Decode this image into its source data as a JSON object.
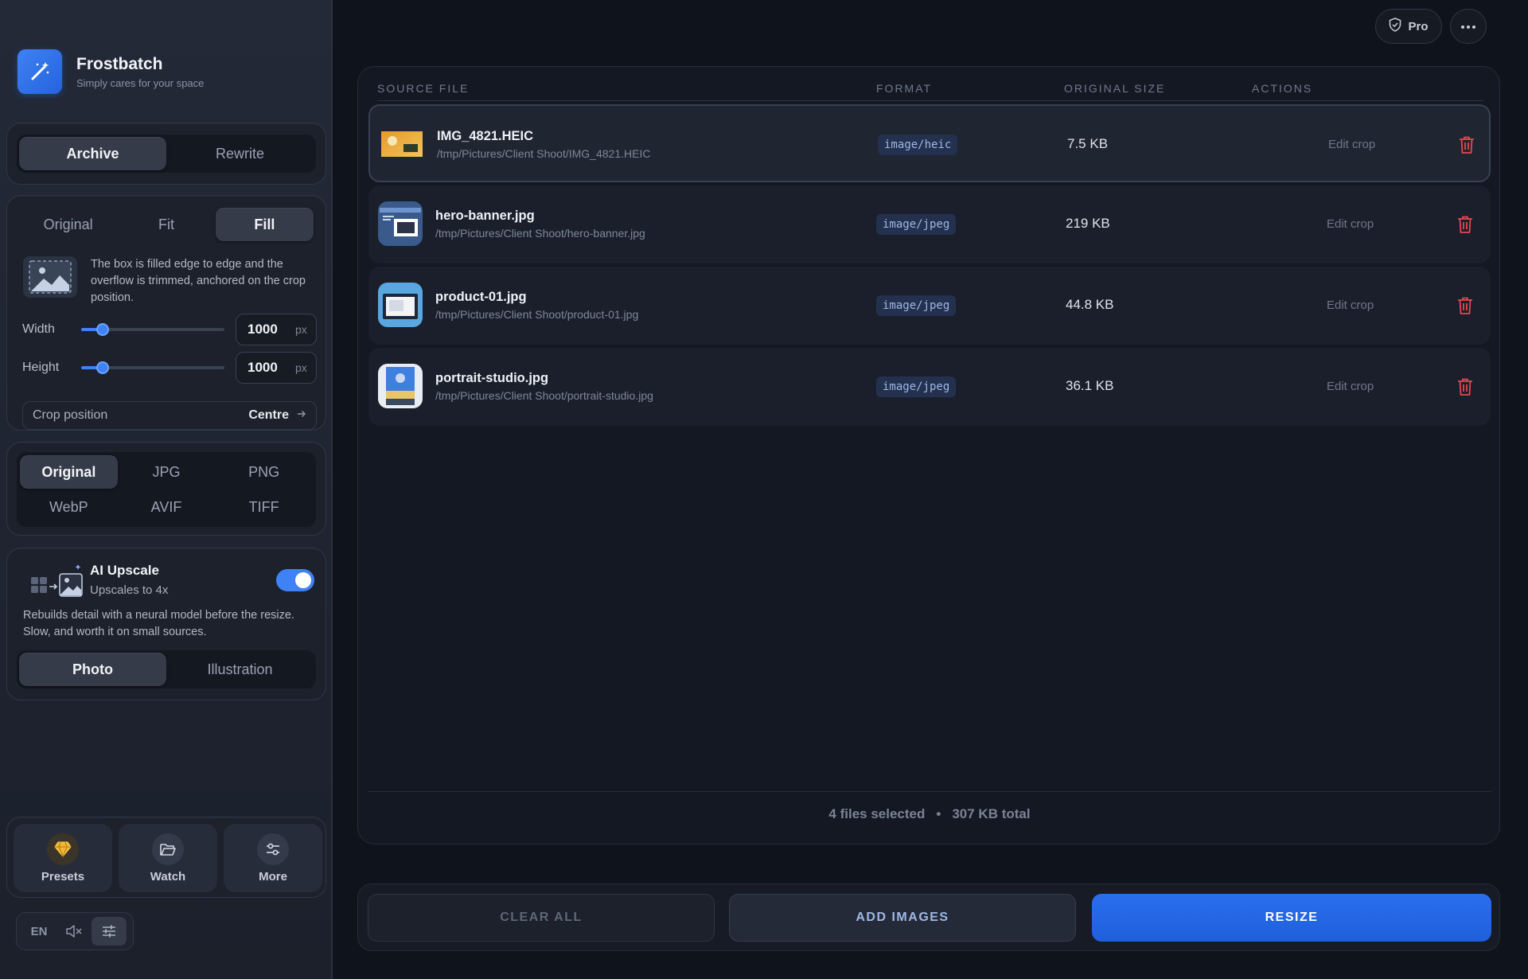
{
  "app": {
    "name": "Frostbatch",
    "tagline": "Simply cares for your space"
  },
  "mode_tabs": {
    "items": [
      "Archive",
      "Rewrite"
    ],
    "active": "Archive"
  },
  "resize": {
    "tabs": [
      "Original",
      "Fit",
      "Fill"
    ],
    "active": "Fill",
    "description": "The box is filled edge to edge and the overflow is trimmed, anchored on the crop position.",
    "width": {
      "label": "Width",
      "value": "1000",
      "unit": "px",
      "slider_fraction": 0.15
    },
    "height": {
      "label": "Height",
      "value": "1000",
      "unit": "px",
      "slider_fraction": 0.15
    },
    "crop": {
      "label": "Crop position",
      "value": "Centre"
    }
  },
  "format_tabs": {
    "items": [
      "Original",
      "JPG",
      "PNG",
      "WebP",
      "AVIF",
      "TIFF"
    ],
    "active": "Original"
  },
  "upscale": {
    "title": "AI Upscale",
    "subtitle": "Upscales to 4x",
    "enabled": true,
    "description": "Rebuilds detail with a neural model before the resize. Slow, and worth it on small sources.",
    "models": [
      "Photo",
      "Illustration"
    ],
    "active_model": "Photo"
  },
  "nav": {
    "presets": "Presets",
    "watch": "Watch",
    "more": "More"
  },
  "footer": {
    "lang": "EN"
  },
  "top": {
    "pro_label": "Pro"
  },
  "table": {
    "headers": {
      "source": "SOURCE FILE",
      "format": "FORMAT",
      "size": "ORIGINAL SIZE",
      "actions": "ACTIONS"
    },
    "edit_label": "Edit crop",
    "rows": [
      {
        "name": "IMG_4821.HEIC",
        "path": "/tmp/Pictures/Client Shoot/IMG_4821.HEIC",
        "format": "image/heic",
        "size": "7.5 KB",
        "selected": true
      },
      {
        "name": "hero-banner.jpg",
        "path": "/tmp/Pictures/Client Shoot/hero-banner.jpg",
        "format": "image/jpeg",
        "size": "219 KB",
        "selected": false
      },
      {
        "name": "product-01.jpg",
        "path": "/tmp/Pictures/Client Shoot/product-01.jpg",
        "format": "image/jpeg",
        "size": "44.8 KB",
        "selected": false
      },
      {
        "name": "portrait-studio.jpg",
        "path": "/tmp/Pictures/Client Shoot/portrait-studio.jpg",
        "format": "image/jpeg",
        "size": "36.1 KB",
        "selected": false
      }
    ],
    "summary": {
      "selected": "4 files selected",
      "total": "307 KB total"
    }
  },
  "actions": {
    "clear": "CLEAR ALL",
    "add": "ADD IMAGES",
    "resize": "RESIZE"
  },
  "colors": {
    "accent": "#3f82f5",
    "danger": "#e5484d",
    "panel": "#131823"
  }
}
